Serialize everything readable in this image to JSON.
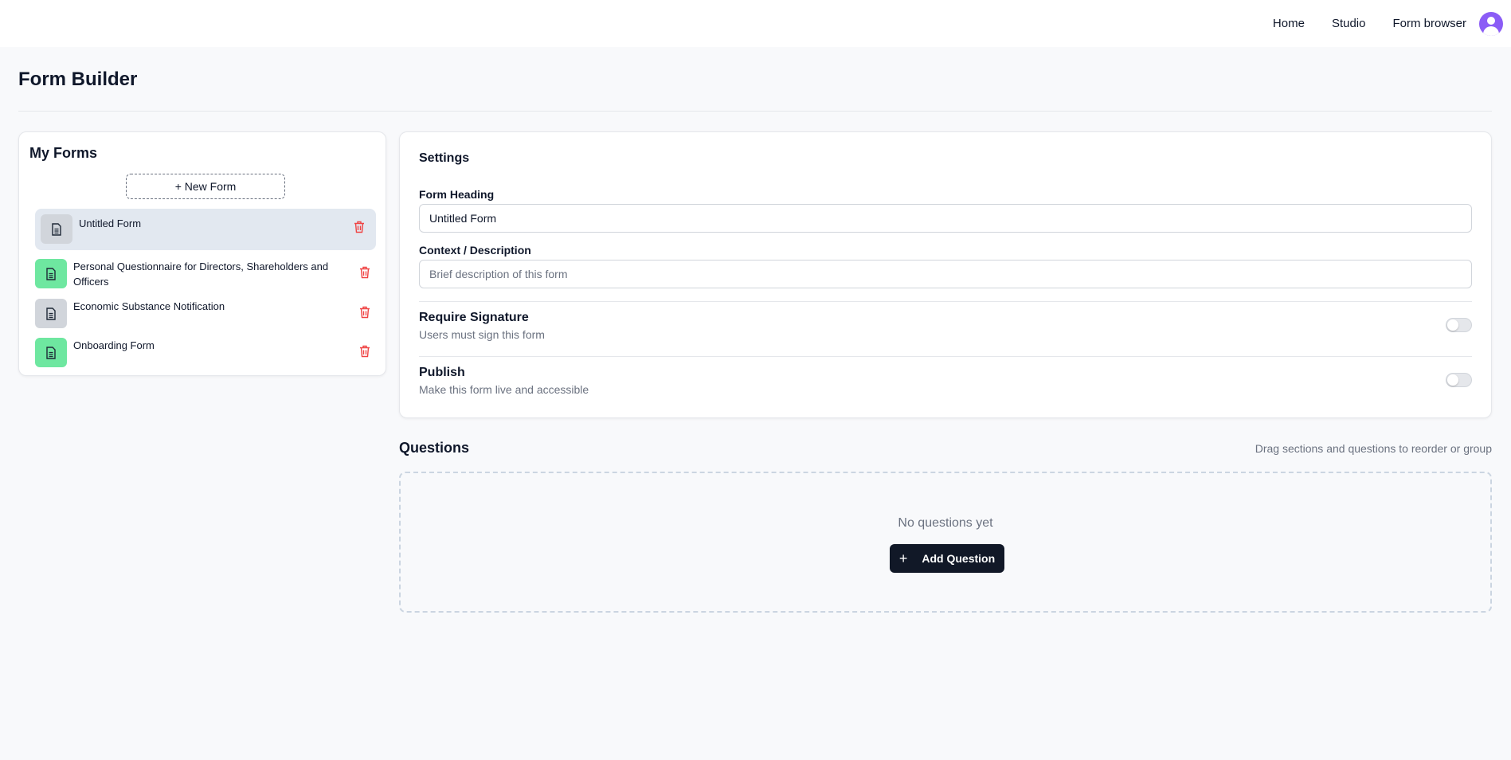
{
  "nav": {
    "links": [
      "Home",
      "Studio",
      "Form browser"
    ]
  },
  "page": {
    "title": "Form Builder"
  },
  "sidebar": {
    "title": "My Forms",
    "new_form_label": "+ New Form",
    "forms": [
      {
        "name": "Untitled Form",
        "status": "draft",
        "selected": true
      },
      {
        "name": "Personal Questionnaire for Directors, Shareholders and Officers",
        "status": "published"
      },
      {
        "name": "Economic Substance Notification",
        "status": "draft"
      },
      {
        "name": "Onboarding Form",
        "status": "published"
      }
    ]
  },
  "settings": {
    "title": "Settings",
    "heading_label": "Form Heading",
    "heading_value": "Untitled Form",
    "description_label": "Context / Description",
    "description_placeholder": "Brief description of this form",
    "signature_title": "Require Signature",
    "signature_sub": "Users must sign this form",
    "signature_on": false,
    "publish_title": "Publish",
    "publish_sub": "Make this form live and accessible",
    "publish_on": false
  },
  "questions": {
    "title": "Questions",
    "hint": "Drag sections and questions to reorder or group",
    "empty_text": "No questions yet",
    "add_label": "Add Question"
  },
  "colors": {
    "accent": "#111827",
    "avatar": "#8b5cf6",
    "published_badge": "#6ee7a0",
    "draft_badge": "#d1d5db",
    "delete": "#ef4444"
  }
}
